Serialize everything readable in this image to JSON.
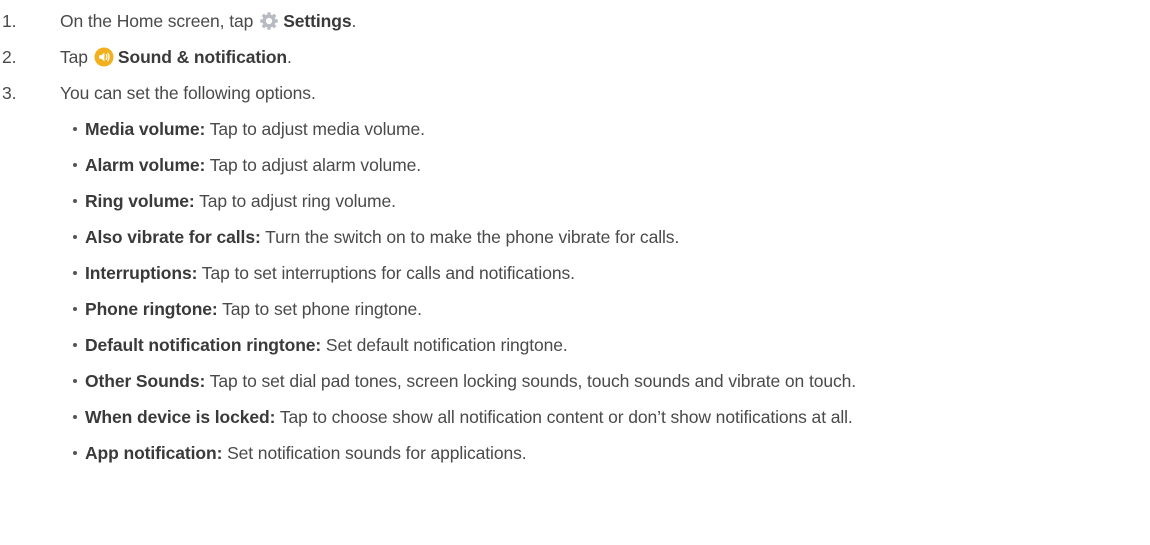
{
  "steps": [
    {
      "num": "1.",
      "pre": "On the Home screen, tap",
      "icon": "settings-gear-icon",
      "bold": "Settings",
      "post": "."
    },
    {
      "num": "2.",
      "pre": "Tap",
      "icon": "sound-notification-icon",
      "bold": "Sound & notification",
      "post": "."
    },
    {
      "num": "3.",
      "pre": "You can set the following options."
    }
  ],
  "options": [
    {
      "term": "Media volume:",
      "desc": "Tap to adjust media volume."
    },
    {
      "term": "Alarm volume:",
      "desc": "Tap to adjust alarm volume."
    },
    {
      "term": "Ring volume:",
      "desc": "Tap to adjust ring volume."
    },
    {
      "term": "Also vibrate for calls:",
      "desc": "Turn the switch on to make the phone vibrate for calls."
    },
    {
      "term": "Interruptions:",
      "desc": "Tap to set interruptions for calls and notifications."
    },
    {
      "term": "Phone ringtone:",
      "desc": "Tap to set phone ringtone."
    },
    {
      "term": "Default notification ringtone:",
      "desc": "Set default notification ringtone."
    },
    {
      "term": "Other Sounds:",
      "desc": "Tap to set dial pad tones, screen locking sounds, touch sounds and vibrate on touch."
    },
    {
      "term": "When device is locked:",
      "desc": "Tap to choose show all notification content or don’t show notifications at all."
    },
    {
      "term": "App notification:",
      "desc": "Set notification sounds for applications."
    }
  ],
  "colors": {
    "text": "#4a4a4a",
    "bold": "#3a3a3a",
    "settings_icon": "#b8bcc2",
    "sound_icon": "#f2b01e"
  }
}
